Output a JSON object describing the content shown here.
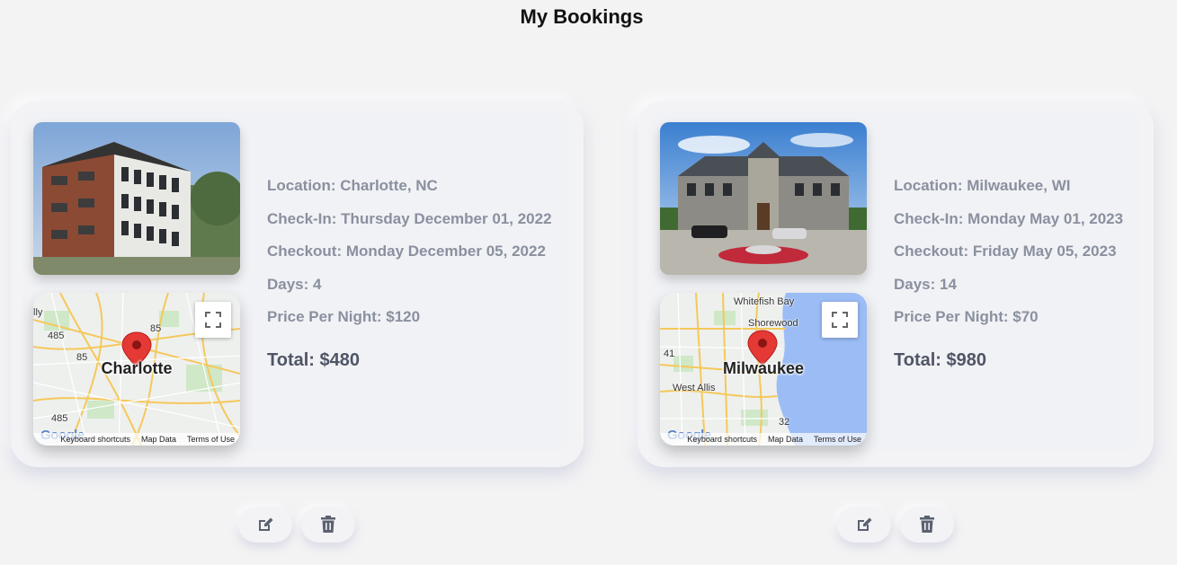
{
  "page": {
    "title": "My Bookings"
  },
  "bookings": [
    {
      "location": "Location: Charlotte, NC",
      "checkin": "Check-In: Thursday December 01, 2022",
      "checkout": "Checkout: Monday December 05, 2022",
      "days": "Days: 4",
      "price": "Price Per Night: $120",
      "total": "Total: $480",
      "map": {
        "city": "Charlotte",
        "keyboard": "Keyboard shortcuts",
        "mapdata": "Map Data",
        "terms": "Terms of Use",
        "google": "Google",
        "labels": [
          "lly",
          "485",
          "85",
          "85",
          "485"
        ]
      }
    },
    {
      "location": "Location: Milwaukee, WI",
      "checkin": "Check-In: Monday May 01, 2023",
      "checkout": "Checkout: Friday May 05, 2023",
      "days": "Days: 14",
      "price": "Price Per Night: $70",
      "total": "Total: $980",
      "map": {
        "city": "Milwaukee",
        "keyboard": "Keyboard shortcuts",
        "mapdata": "Map Data",
        "terms": "Terms of Use",
        "google": "Google",
        "labels": [
          "Whitefish Bay",
          "Shorewood",
          "West Allis",
          "41",
          "32"
        ]
      }
    }
  ],
  "icons": {
    "edit": "edit-icon",
    "delete": "trash-icon",
    "fullscreen": "fullscreen-icon",
    "pin": "map-pin-icon"
  },
  "colors": {
    "map_water": "#9bbcf5",
    "map_land": "#eef0ee",
    "pin": "#e53935",
    "road": "#f6cf6a"
  }
}
